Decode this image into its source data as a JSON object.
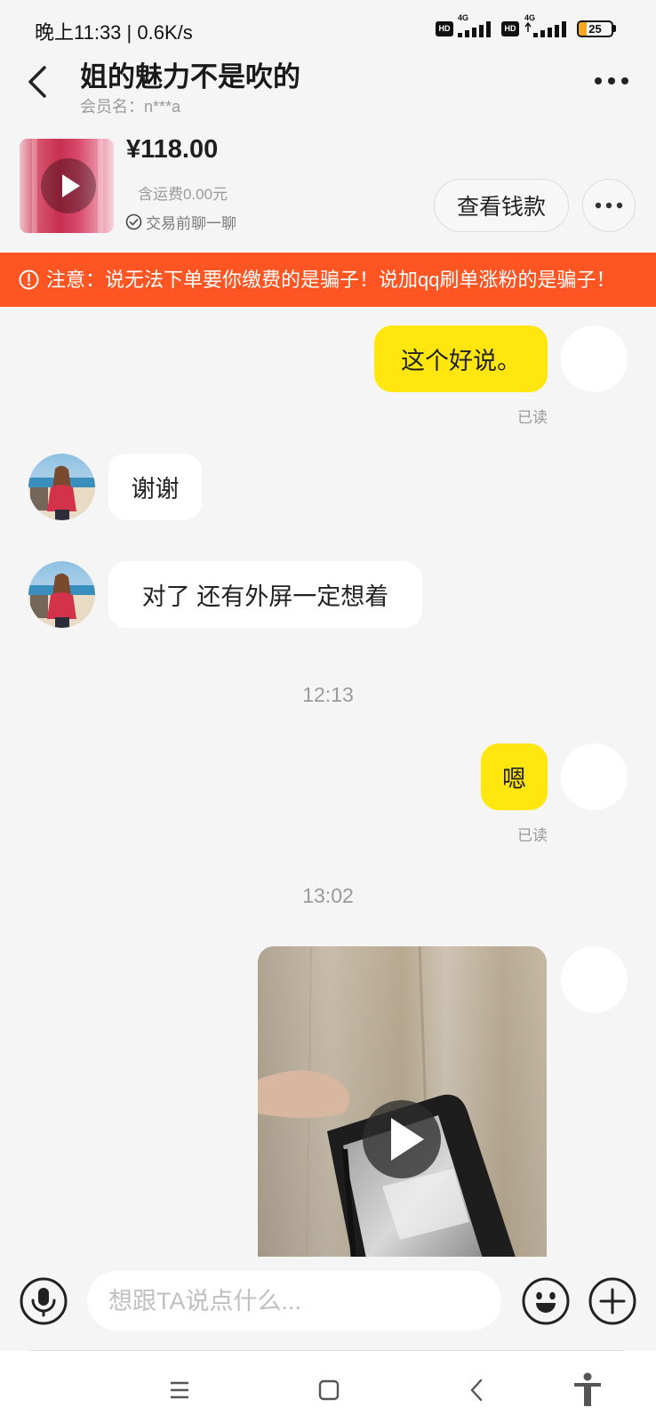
{
  "status_bar": {
    "time": "晚上11:33 | 0.6K/s",
    "sim1": {
      "hd": "HD",
      "network": "4G"
    },
    "sim2": {
      "hd": "HD",
      "network": "4G"
    },
    "battery": "25",
    "battery_level": 0.25
  },
  "header": {
    "title": "姐的魅力不是吹的",
    "member": "会员名：n***a",
    "icons": {
      "back": "back-arrow-icon",
      "more": "more-icon"
    }
  },
  "product": {
    "price": "¥118.00",
    "shipping": "含运费0.00元",
    "tip": "交易前聊一聊",
    "view_money": "查看钱款",
    "icons": {
      "thumbnail_play": "play-icon",
      "tip": "check-circle-icon",
      "more": "more-icon"
    }
  },
  "warning": {
    "text": "注意：说无法下单要你缴费的是骗子！说加qq刷单涨粉的是骗子！",
    "icon": "alert-circle-icon"
  },
  "chat": {
    "messages": [
      {
        "text": "这个好说。",
        "read": "已读"
      },
      {
        "text": "谢谢"
      },
      {
        "text": "对了 还有外屏一定想着"
      },
      {
        "time": "12:13"
      },
      {
        "text": "嗯",
        "read": "已读"
      },
      {
        "time": "13:02"
      },
      {
        "video_icon": "play-icon"
      }
    ]
  },
  "input": {
    "placeholder": "想跟TA说点什么...",
    "icons": {
      "voice": "microphone-icon",
      "emoji": "emoji-icon",
      "more": "plus-icon"
    }
  },
  "nav": {
    "icons": [
      "menu-icon",
      "home-icon",
      "back-icon",
      "accessibility-icon"
    ]
  },
  "colors": {
    "bubble_self": "#FFE60F",
    "bubble_other": "#FFFFFF",
    "warning_bg": "#FF5523",
    "chat_bg": "#F5F5F5",
    "text": "#222222",
    "muted": "#999999"
  }
}
